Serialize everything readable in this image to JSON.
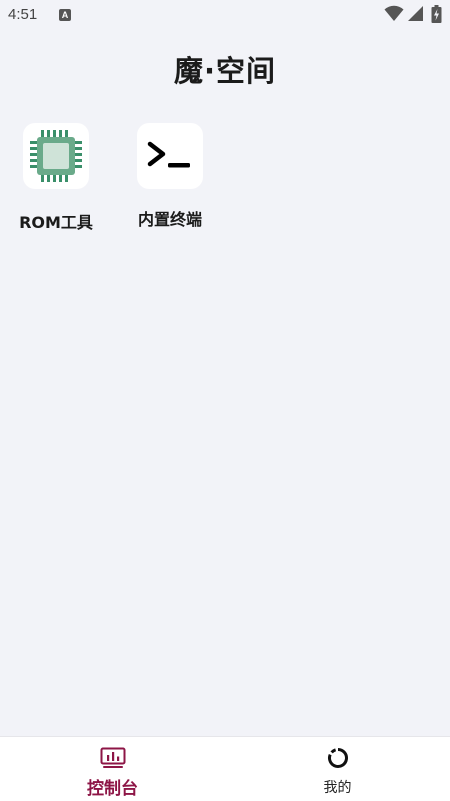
{
  "status_bar": {
    "time": "4:51",
    "badge": "A",
    "icons": [
      "wifi-icon",
      "signal-icon",
      "battery-charging-icon"
    ]
  },
  "header": {
    "title": "魔·空间"
  },
  "tiles": [
    {
      "label": "ROM工具",
      "icon": "chip-icon"
    },
    {
      "label": "内置终端",
      "icon": "terminal-icon"
    }
  ],
  "bottom_nav": {
    "items": [
      {
        "label": "控制台",
        "icon": "dashboard-icon",
        "active": true
      },
      {
        "label": "我的",
        "icon": "profile-ring-icon",
        "active": false
      }
    ]
  },
  "colors": {
    "accent": "#8d1546",
    "background": "#f2f3f8",
    "chip_green": "#3a8f6a",
    "chip_light": "#cfe3d8"
  }
}
